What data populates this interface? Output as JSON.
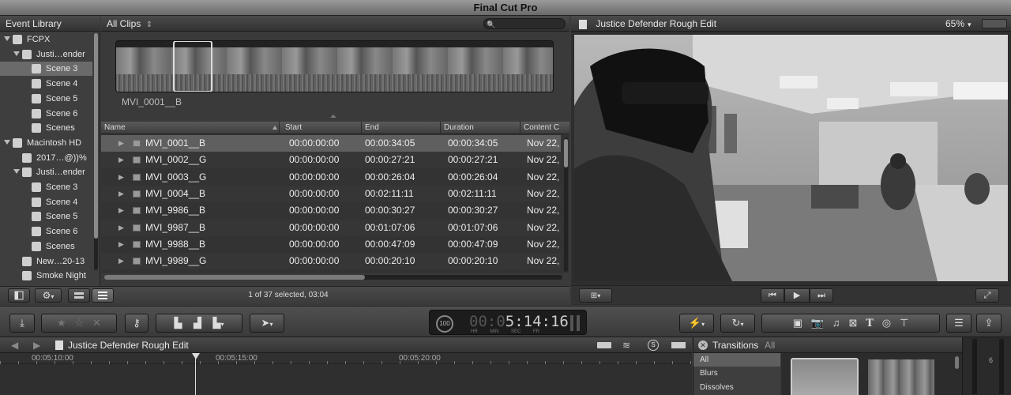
{
  "app": {
    "title": "Final Cut Pro"
  },
  "library": {
    "header": "Event Library",
    "items": [
      {
        "label": "FCPX",
        "indent": 0,
        "icon": "drive-icon",
        "expanded": true
      },
      {
        "label": "Justi…ender",
        "indent": 1,
        "icon": "event-icon",
        "expanded": true
      },
      {
        "label": "Scene 3",
        "indent": 2,
        "icon": "keyword-icon",
        "selected": true
      },
      {
        "label": "Scene 4",
        "indent": 2,
        "icon": "keyword-icon"
      },
      {
        "label": "Scene 5",
        "indent": 2,
        "icon": "keyword-icon"
      },
      {
        "label": "Scene 6",
        "indent": 2,
        "icon": "keyword-icon"
      },
      {
        "label": "Scenes",
        "indent": 2,
        "icon": "keyword-icon"
      },
      {
        "label": "Macintosh HD",
        "indent": 0,
        "icon": "home-icon",
        "expanded": true
      },
      {
        "label": "2017…@))%",
        "indent": 1,
        "icon": "event-icon"
      },
      {
        "label": "Justi…ender",
        "indent": 1,
        "icon": "event-icon",
        "expanded": true
      },
      {
        "label": "Scene 3",
        "indent": 2,
        "icon": "keyword-icon"
      },
      {
        "label": "Scene 4",
        "indent": 2,
        "icon": "keyword-icon"
      },
      {
        "label": "Scene 5",
        "indent": 2,
        "icon": "keyword-icon"
      },
      {
        "label": "Scene 6",
        "indent": 2,
        "icon": "keyword-icon"
      },
      {
        "label": "Scenes",
        "indent": 2,
        "icon": "keyword-icon"
      },
      {
        "label": "New…20-13",
        "indent": 1,
        "icon": "event-icon"
      },
      {
        "label": "Smoke Night",
        "indent": 1,
        "icon": "event-icon"
      }
    ]
  },
  "browser": {
    "filter": "All Clips",
    "filter_arrow": "⇕",
    "search_placeholder": "",
    "search_icon": "🔍",
    "clip_name": "MVI_0001__B",
    "columns": [
      "Name",
      "Start",
      "End",
      "Duration",
      "Content C"
    ],
    "rows": [
      {
        "name": "MVI_0001__B",
        "start": "00:00:00:00",
        "end": "00:00:34:05",
        "duration": "00:00:34:05",
        "content": "Nov 22,"
      },
      {
        "name": "MVI_0002__G",
        "start": "00:00:00:00",
        "end": "00:00:27:21",
        "duration": "00:00:27:21",
        "content": "Nov 22,"
      },
      {
        "name": "MVI_0003__G",
        "start": "00:00:00:00",
        "end": "00:00:26:04",
        "duration": "00:00:26:04",
        "content": "Nov 22,"
      },
      {
        "name": "MVI_0004__B",
        "start": "00:00:00:00",
        "end": "00:02:11:11",
        "duration": "00:02:11:11",
        "content": "Nov 22,"
      },
      {
        "name": "MVI_9986__B",
        "start": "00:00:00:00",
        "end": "00:00:30:27",
        "duration": "00:00:30:27",
        "content": "Nov 22,"
      },
      {
        "name": "MVI_9987__B",
        "start": "00:00:00:00",
        "end": "00:01:07:06",
        "duration": "00:01:07:06",
        "content": "Nov 22,"
      },
      {
        "name": "MVI_9988__B",
        "start": "00:00:00:00",
        "end": "00:00:47:09",
        "duration": "00:00:47:09",
        "content": "Nov 22,"
      },
      {
        "name": "MVI_9989__G",
        "start": "00:00:00:00",
        "end": "00:00:20:10",
        "duration": "00:00:20:10",
        "content": "Nov 22,"
      }
    ],
    "status": "1 of 37 selected, 03:04"
  },
  "viewer": {
    "title": "Justice Defender Rough Edit",
    "zoom": "65%"
  },
  "toolbar": {
    "timecode": "5:14:16",
    "timecode_dim": "00:0",
    "timecode_labels": [
      "HR",
      "MIN",
      "SEC",
      "FR"
    ],
    "percent": "100"
  },
  "timeline": {
    "project": "Justice Defender Rough Edit",
    "ruler": [
      "00:05:10:00",
      "00:05:15:00",
      "00:05:20:00"
    ]
  },
  "transitions": {
    "title": "Transitions",
    "filter": "All",
    "categories": [
      "All",
      "Blurs",
      "Dissolves"
    ],
    "selected_category": "All"
  },
  "meter": {
    "value": "6"
  }
}
